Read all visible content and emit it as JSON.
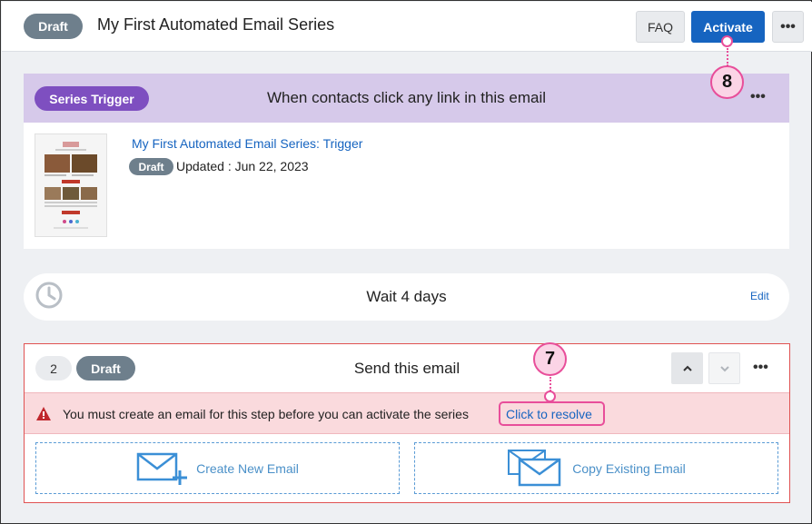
{
  "header": {
    "status": "Draft",
    "title": "My First Automated Email Series",
    "faq_label": "FAQ",
    "activate_label": "Activate",
    "more_label": "•••"
  },
  "trigger": {
    "badge": "Series Trigger",
    "description": "When contacts click any link in this email",
    "more_label": "•••",
    "email_name": "My First Automated Email Series: Trigger",
    "email_status": "Draft",
    "updated": "Updated : Jun 22, 2023"
  },
  "wait": {
    "text": "Wait 4 days",
    "edit_label": "Edit"
  },
  "step": {
    "number": "2",
    "status": "Draft",
    "title": "Send this email",
    "more_label": "•••",
    "error_text": "You must create an email for this step before you can activate the series",
    "resolve_label": "Click to resolve",
    "create_label": "Create New Email",
    "copy_label": "Copy Existing Email"
  },
  "callouts": {
    "activate": "8",
    "resolve": "7"
  },
  "colors": {
    "primary": "#1664c0",
    "draft": "#6e7f8c",
    "trigger": "#7e4fc0",
    "trigger_bar": "#d6c9ea",
    "error_bg": "#fadadd",
    "error_border": "#e05252",
    "callout": "#e84e9a"
  },
  "icons": {
    "clock": "clock-icon",
    "warning": "warning-icon",
    "create_email": "envelope-plus-icon",
    "copy_email": "envelopes-copy-icon",
    "up": "chevron-up-icon",
    "down": "chevron-down-icon"
  }
}
